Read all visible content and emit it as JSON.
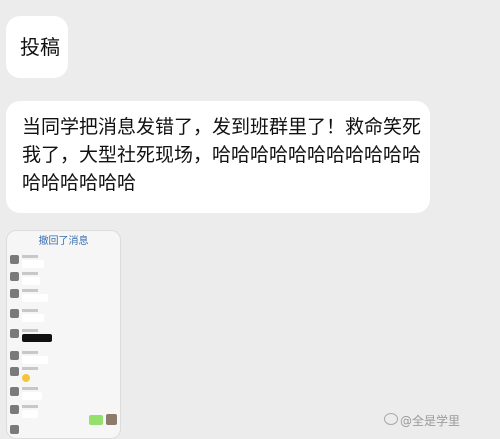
{
  "post": {
    "tag": "投稿",
    "message": "当同学把消息发错了，发到班群里了！救命笑死我了，大型社死现场，哈哈哈哈哈哈哈哈哈哈哈哈哈哈哈哈哈"
  },
  "screenshot": {
    "title": "撤回了消息"
  },
  "watermark": "@全是学里",
  "icons": {
    "weibo": "weibo-icon"
  }
}
